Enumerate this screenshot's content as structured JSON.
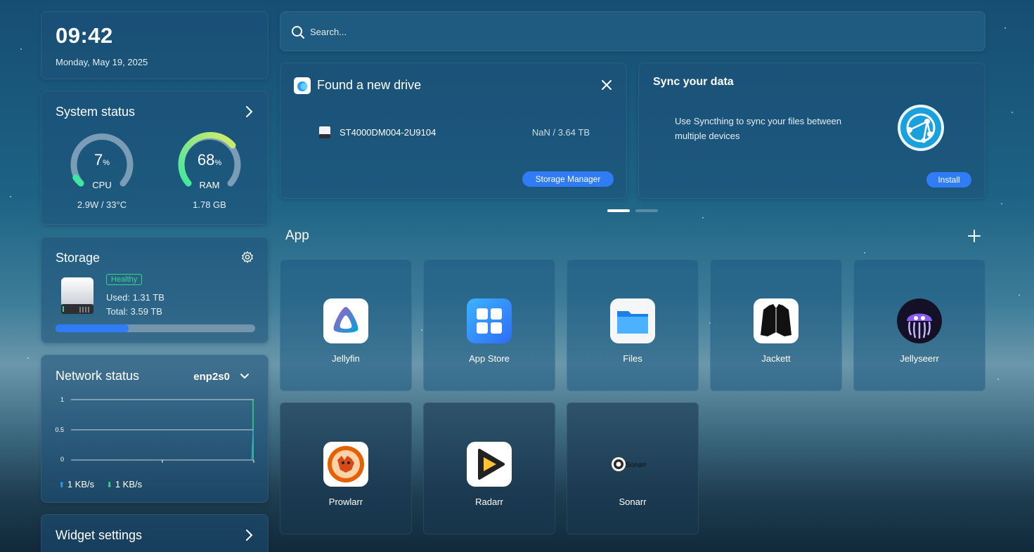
{
  "clock": {
    "time": "09:42",
    "date": "Monday, May 19, 2025"
  },
  "system": {
    "title": "System status",
    "cpu": {
      "value": "7",
      "unit": "%",
      "label": "CPU",
      "detail": "2.9W / 33°C",
      "percent": 7
    },
    "ram": {
      "value": "68",
      "unit": "%",
      "label": "RAM",
      "detail": "1.78 GB",
      "percent": 68
    }
  },
  "storage": {
    "title": "Storage",
    "badge": "Healthy",
    "used": "Used: 1.31 TB",
    "total": "Total: 3.59 TB",
    "used_fraction": 0.365
  },
  "network": {
    "title": "Network status",
    "interface": "enp2s0",
    "y_ticks": [
      "1",
      "0.5",
      "0"
    ],
    "upload": "1 KB/s",
    "download": "1 KB/s"
  },
  "widget_settings": {
    "title": "Widget settings"
  },
  "search": {
    "placeholder": "Search..."
  },
  "drive_card": {
    "title": "Found a new drive",
    "drive_name": "ST4000DM004-2U9104",
    "drive_size": "NaN / 3.64 TB",
    "button": "Storage Manager"
  },
  "sync_card": {
    "title": "Sync your data",
    "description": "Use Syncthing to sync your files between multiple devices",
    "button": "Install"
  },
  "apps": {
    "heading": "App",
    "items": [
      {
        "name": "Jellyfin",
        "icon": "jellyfin-icon"
      },
      {
        "name": "App Store",
        "icon": "app-store-icon"
      },
      {
        "name": "Files",
        "icon": "folder-icon"
      },
      {
        "name": "Jackett",
        "icon": "jackett-icon"
      },
      {
        "name": "Jellyseerr",
        "icon": "jellyseerr-icon"
      },
      {
        "name": "Prowlarr",
        "icon": "prowlarr-icon"
      },
      {
        "name": "Radarr",
        "icon": "radarr-icon"
      },
      {
        "name": "Sonarr",
        "icon": "sonarr-icon",
        "icon_text": "Sonarr"
      }
    ]
  },
  "colors": {
    "accent": "#2f7cf6",
    "healthy": "#3bd489",
    "ram_gauge_start": "#3ee8a0",
    "ram_gauge_end": "#d8ea6a",
    "cpu_gauge": "#3ee8a0"
  }
}
